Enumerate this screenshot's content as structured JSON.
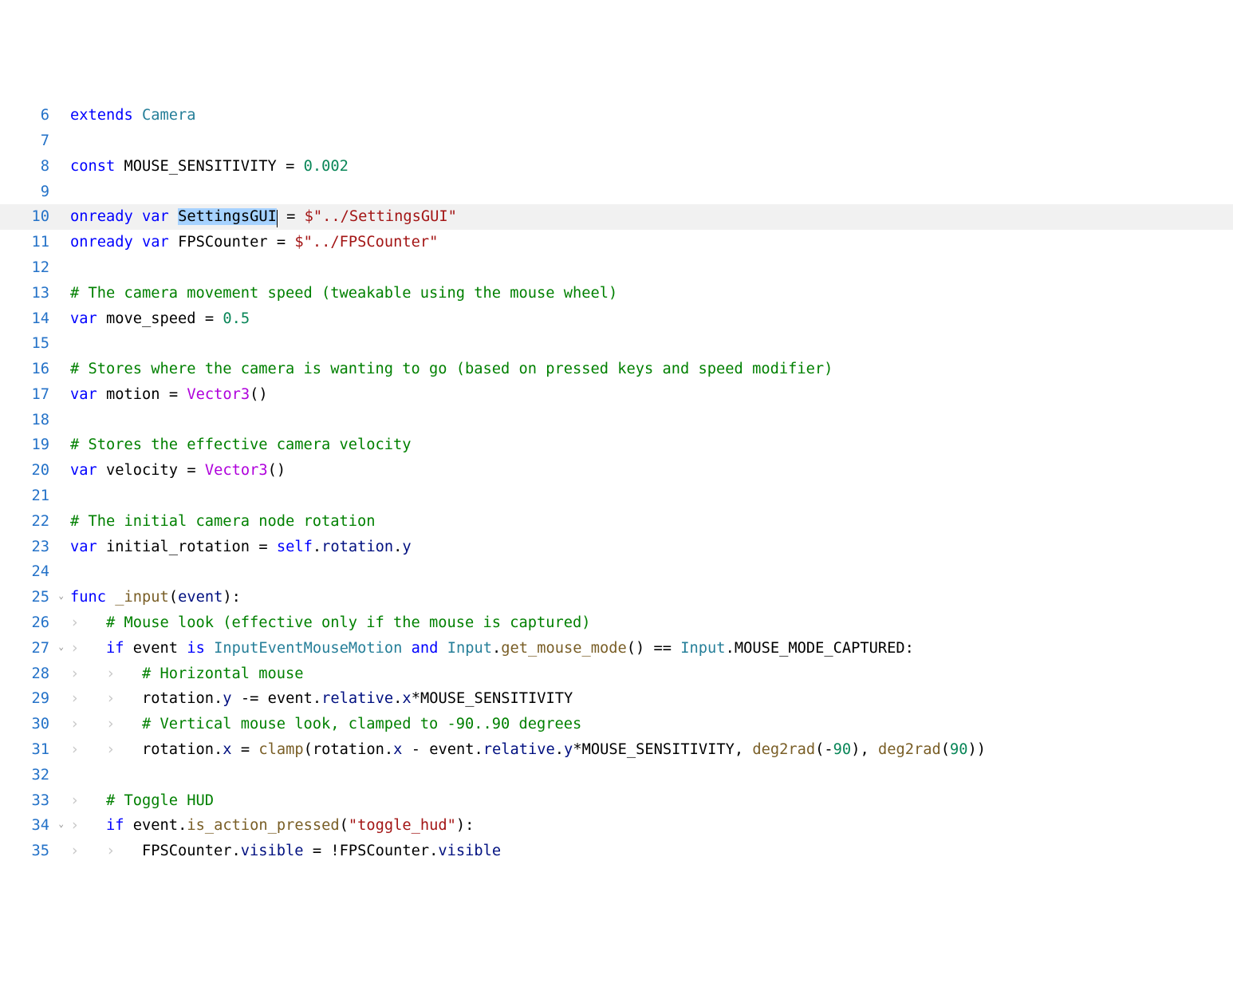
{
  "editor": {
    "selection_text": "SettingsGUI",
    "current_line": 10,
    "lines": [
      {
        "num": "6",
        "fold": false
      },
      {
        "num": "7",
        "fold": false
      },
      {
        "num": "8",
        "fold": false
      },
      {
        "num": "9",
        "fold": false
      },
      {
        "num": "10",
        "fold": false
      },
      {
        "num": "11",
        "fold": false
      },
      {
        "num": "12",
        "fold": false
      },
      {
        "num": "13",
        "fold": false
      },
      {
        "num": "14",
        "fold": false
      },
      {
        "num": "15",
        "fold": false
      },
      {
        "num": "16",
        "fold": false
      },
      {
        "num": "17",
        "fold": false
      },
      {
        "num": "18",
        "fold": false
      },
      {
        "num": "19",
        "fold": false
      },
      {
        "num": "20",
        "fold": false
      },
      {
        "num": "21",
        "fold": false
      },
      {
        "num": "22",
        "fold": false
      },
      {
        "num": "23",
        "fold": false
      },
      {
        "num": "24",
        "fold": false
      },
      {
        "num": "25",
        "fold": true
      },
      {
        "num": "26",
        "fold": false
      },
      {
        "num": "27",
        "fold": true
      },
      {
        "num": "28",
        "fold": false
      },
      {
        "num": "29",
        "fold": false
      },
      {
        "num": "30",
        "fold": false
      },
      {
        "num": "31",
        "fold": false
      },
      {
        "num": "32",
        "fold": false
      },
      {
        "num": "33",
        "fold": false
      },
      {
        "num": "34",
        "fold": true
      },
      {
        "num": "35",
        "fold": false
      }
    ],
    "tokens": {
      "l6": {
        "extends": "extends",
        "Camera": "Camera"
      },
      "l8": {
        "const": "const",
        "MOUSE_SENSITIVITY": "MOUSE_SENSITIVITY",
        "eq": "=",
        "val": "0.002"
      },
      "l10": {
        "onready": "onready",
        "var": "var",
        "SettingsGUI": "SettingsGUI",
        "eq": "=",
        "dollar": "$",
        "path": "\"../SettingsGUI\""
      },
      "l11": {
        "onready": "onready",
        "var": "var",
        "FPSCounter": "FPSCounter",
        "eq": "=",
        "dollar": "$",
        "path": "\"../FPSCounter\""
      },
      "l13": {
        "c": "# The camera movement speed (tweakable using the mouse wheel)"
      },
      "l14": {
        "var": "var",
        "move_speed": "move_speed",
        "eq": "=",
        "val": "0.5"
      },
      "l16": {
        "c": "# Stores where the camera is wanting to go (based on pressed keys and speed modifier)"
      },
      "l17": {
        "var": "var",
        "motion": "motion",
        "eq": "=",
        "Vector3": "Vector3",
        "p": "()"
      },
      "l19": {
        "c": "# Stores the effective camera velocity"
      },
      "l20": {
        "var": "var",
        "velocity": "velocity",
        "eq": "=",
        "Vector3": "Vector3",
        "p": "()"
      },
      "l22": {
        "c": "# The initial camera node rotation"
      },
      "l23": {
        "var": "var",
        "initial_rotation": "initial_rotation",
        "eq": "=",
        "self": "self",
        "d1": ".",
        "rotation": "rotation",
        "d2": ".",
        "y": "y"
      },
      "l25": {
        "func": "func",
        "name": "_input",
        "lp": "(",
        "event": "event",
        "rp": ")",
        "colon": ":"
      },
      "l26": {
        "c": "# Mouse look (effective only if the mouse is captured)"
      },
      "l27": {
        "if": "if",
        "event": "event",
        "is": "is",
        "IEMM": "InputEventMouseMotion",
        "and": "and",
        "Input": "Input",
        "d1": ".",
        "get_mouse_mode": "get_mouse_mode",
        "p": "()",
        "eqeq": "==",
        "Input2": "Input",
        "d2": ".",
        "MMC": "MOUSE_MODE_CAPTURED",
        "colon": ":"
      },
      "l28": {
        "c": "# Horizontal mouse"
      },
      "l29": {
        "rotation": "rotation",
        "d1": ".",
        "y": "y",
        "minuseq": "-=",
        "event": "event",
        "d2": ".",
        "relative": "relative",
        "d3": ".",
        "x": "x",
        "star": "*",
        "MS": "MOUSE_SENSITIVITY"
      },
      "l30": {
        "c": "# Vertical mouse look, clamped to -90..90 degrees"
      },
      "l31": {
        "rotation": "rotation",
        "d1": ".",
        "x": "x",
        "eq": "=",
        "clamp": "clamp",
        "lp": "(",
        "rotation2": "rotation",
        "d2": ".",
        "x2": "x",
        "minus": "-",
        "event": "event",
        "d3": ".",
        "relative": "relative",
        "d4": ".",
        "y": "y",
        "star": "*",
        "MS": "MOUSE_SENSITIVITY",
        "c1": ",",
        "deg2rad1": "deg2rad",
        "lp2": "(",
        "neg90": "-",
        "n90": "90",
        "rp2": ")",
        "c2": ",",
        "deg2rad2": "deg2rad",
        "lp3": "(",
        "p90": "90",
        "rp3": ")",
        "rp": ")"
      },
      "l33": {
        "c": "# Toggle HUD"
      },
      "l34": {
        "if": "if",
        "event": "event",
        "d1": ".",
        "iap": "is_action_pressed",
        "lp": "(",
        "s": "\"toggle_hud\"",
        "rp": ")",
        "colon": ":"
      },
      "l35": {
        "FPSCounter": "FPSCounter",
        "d1": ".",
        "visible": "visible",
        "eq": "=",
        "bang": "!",
        "FPSCounter2": "FPSCounter",
        "d2": ".",
        "visible2": "visible"
      }
    },
    "ws_glyph": "›"
  }
}
